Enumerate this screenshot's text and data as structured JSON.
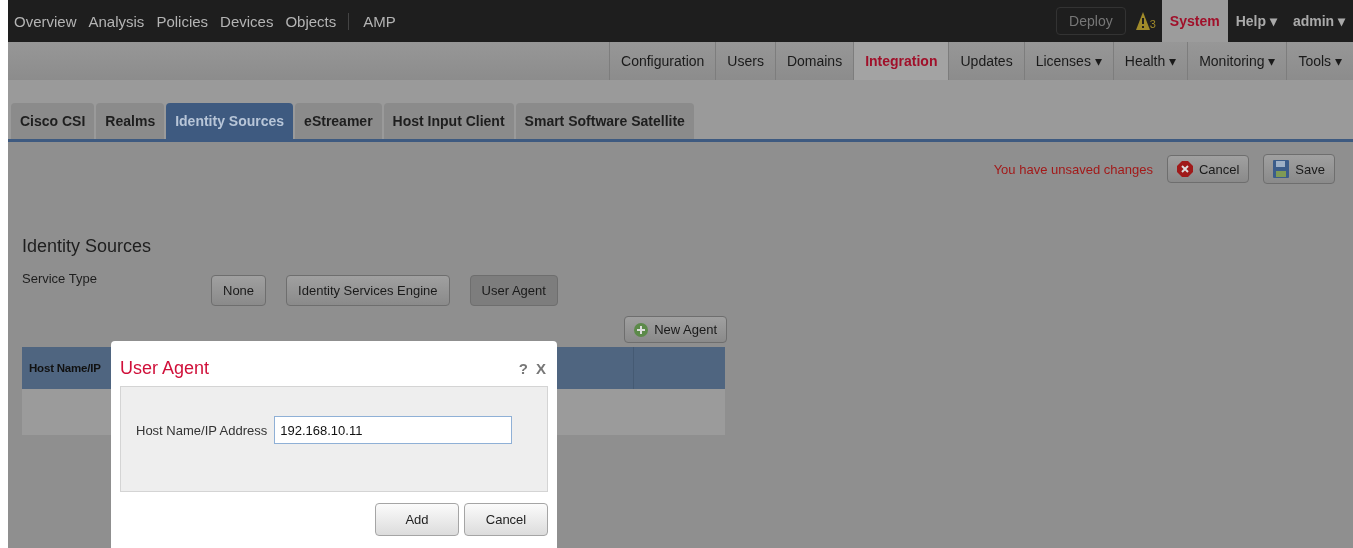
{
  "main_nav": [
    {
      "label": "Overview",
      "selected": false
    },
    {
      "label": "Analysis",
      "selected": false
    },
    {
      "label": "Policies",
      "selected": false
    },
    {
      "label": "Devices",
      "selected": false
    },
    {
      "label": "Objects",
      "selected": false
    },
    {
      "label": "AMP",
      "selected": false
    }
  ],
  "top_right": {
    "deploy": "Deploy",
    "alert_count": "3",
    "menus": [
      {
        "label": "System",
        "selected": true
      },
      {
        "label": "Help ▾",
        "selected": false
      },
      {
        "label": "admin ▾",
        "selected": false
      }
    ]
  },
  "sub_nav": [
    {
      "label": "Configuration",
      "selected": false
    },
    {
      "label": "Users",
      "selected": false
    },
    {
      "label": "Domains",
      "selected": false
    },
    {
      "label": "Integration",
      "selected": true
    },
    {
      "label": "Updates",
      "selected": false
    },
    {
      "label": "Licenses ▾",
      "selected": false
    },
    {
      "label": "Health ▾",
      "selected": false
    },
    {
      "label": "Monitoring ▾",
      "selected": false
    },
    {
      "label": "Tools ▾",
      "selected": false
    }
  ],
  "tabs": [
    {
      "label": "Cisco CSI",
      "selected": false
    },
    {
      "label": "Realms",
      "selected": false
    },
    {
      "label": "Identity Sources",
      "selected": true
    },
    {
      "label": "eStreamer",
      "selected": false
    },
    {
      "label": "Host Input Client",
      "selected": false
    },
    {
      "label": "Smart Software Satellite",
      "selected": false
    }
  ],
  "unsaved_message": "You have unsaved changes",
  "actions": [
    {
      "kind": "cancel",
      "label": "Cancel"
    },
    {
      "kind": "save",
      "label": "Save"
    }
  ],
  "section_title": "Identity Sources",
  "service_type": {
    "label": "Service Type",
    "options": [
      {
        "label": "None",
        "selected": false
      },
      {
        "label": "Identity Services Engine",
        "selected": false
      },
      {
        "label": "User Agent",
        "selected": true
      }
    ]
  },
  "new_agent": "New Agent",
  "table": {
    "columns": [
      "Host Name/IP"
    ]
  },
  "dialog": {
    "title": "User Agent",
    "help": "?",
    "close": "X",
    "field_label": "Host Name/IP Address",
    "field_value": "192.168.10.11",
    "buttons": [
      "Add",
      "Cancel"
    ]
  }
}
